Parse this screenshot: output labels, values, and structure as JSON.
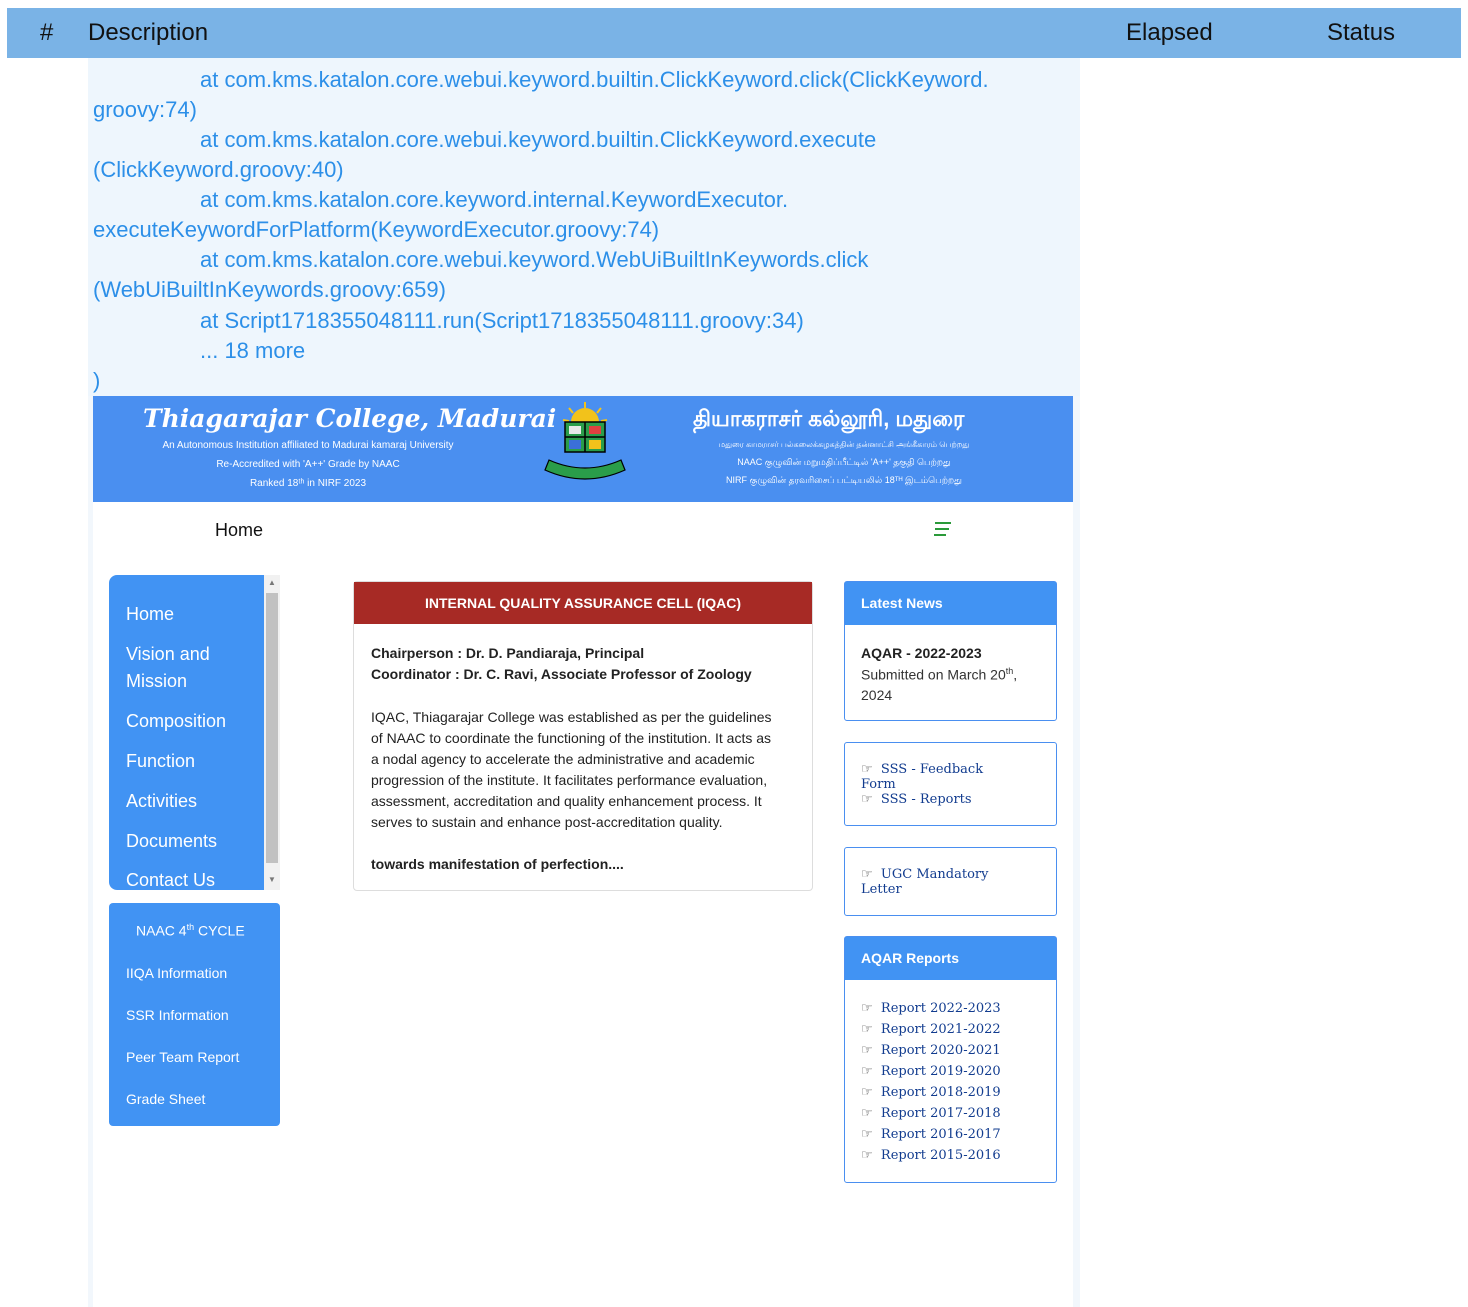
{
  "report": {
    "headers": {
      "num": "#",
      "description": "Description",
      "elapsed": "Elapsed",
      "status": "Status"
    },
    "log_lines": [
      "at com.kms.katalon.core.webui.keyword.builtin.ClickKeyword.click(ClickKeyword.",
      "groovy:74)",
      "at com.kms.katalon.core.webui.keyword.builtin.ClickKeyword.execute",
      "(ClickKeyword.groovy:40)",
      "at com.kms.katalon.core.keyword.internal.KeywordExecutor.",
      "executeKeywordForPlatform(KeywordExecutor.groovy:74)",
      "at com.kms.katalon.core.webui.keyword.WebUiBuiltInKeywords.click",
      "(WebUiBuiltInKeywords.groovy:659)",
      "at Script1718355048111.run(Script1718355048111.groovy:34)",
      "... 18 more",
      ")"
    ]
  },
  "site": {
    "banner": {
      "title_en": "Thiagarajar College, Madurai",
      "lines_en": [
        "An Autonomous Institution affiliated to Madurai kamaraj University",
        "Re-Accredited with 'A++' Grade by NAAC",
        "Ranked 18ᵗʰ in NIRF 2023"
      ],
      "title_ta": "தியாகராசர் கல்லூரி, மதுரை",
      "lines_ta": [
        "மதுரை காமராசர் பல்கலைக்கழகத்தின் தன்னாட்சி அங்கீகாரம் பெற்றது",
        "NAAC குழுவின் மறுமதிப்பீட்டில் 'A++' தகுதி பெற்றது",
        "NIRF குழுவின் தரவரிசைப் பட்டியலில் 18ᵀᴴ இடம்பெற்றது"
      ]
    },
    "nav": {
      "home": "Home"
    },
    "sidebar": [
      "Home",
      "Vision and",
      "Mission",
      "Composition",
      "Function",
      "Activities",
      "Documents",
      "Contact Us"
    ],
    "naac": {
      "title_pre": "NAAC 4",
      "title_sup": "th",
      "title_post": " CYCLE",
      "items": [
        "IIQA Information",
        "SSR Information",
        "Peer Team Report",
        "Grade Sheet"
      ]
    },
    "iqac": {
      "title": "INTERNAL QUALITY ASSURANCE CELL (IQAC)",
      "chairperson": "Chairperson : Dr. D. Pandiaraja, Principal",
      "coordinator": "Coordinator : Dr. C. Ravi, Associate Professor of Zoology",
      "body": [
        "IQAC, Thiagarajar College was established as per the guidelines",
        "of NAAC to coordinate the functioning of the institution. It acts as",
        "a nodal agency to accelerate the administrative and academic",
        "progression of the institute. It facilitates performance evaluation,",
        "assessment, accreditation and quality enhancement process. It",
        "serves to sustain and enhance post-accreditation quality."
      ],
      "motto": "towards manifestation of perfection...."
    },
    "news": {
      "title": "Latest News",
      "item_title": "AQAR - 2022-2023",
      "item_pre": "Submitted on March 20",
      "item_sup": "th",
      "item_post": ",",
      "item_line2": "2024"
    },
    "sss": {
      "feedback_1": "SSS - Feedback",
      "feedback_2": "Form",
      "reports": "SSS - Reports"
    },
    "ugc": {
      "line1": "UGC Mandatory",
      "line2": "Letter"
    },
    "aqar": {
      "title": "AQAR Reports",
      "reports": [
        "Report 2022-2023",
        "Report 2021-2022",
        "Report 2020-2021",
        "Report 2019-2020",
        "Report 2018-2019",
        "Report 2017-2018",
        "Report 2016-2017",
        "Report 2015-2016"
      ]
    },
    "colors": {
      "banner": "#4a8ff0",
      "sidebar": "#4193f3",
      "iqac_header": "#a72a25",
      "report_header": "#7ab3e6",
      "log_text": "#2c8fe8"
    }
  }
}
